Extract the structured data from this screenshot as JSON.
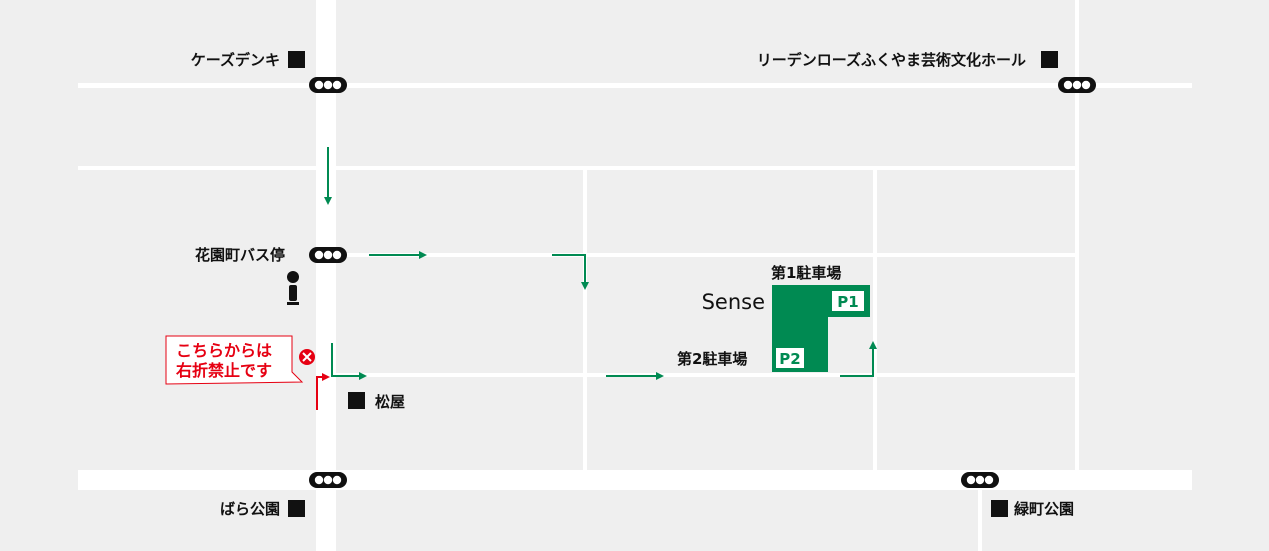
{
  "colors": {
    "route": "#008a52",
    "warning": "#e60012",
    "road": "#ffffff",
    "background": "#efefef"
  },
  "landmarks": {
    "k_denki": "ケーズデンキ",
    "hall": "リーデンローズふくやま芸術文化ホール",
    "bus_stop": "花園町バス停",
    "matsuya": "松屋",
    "bara_park": "ばら公園",
    "midorimachi_park": "緑町公園"
  },
  "destination": {
    "name": "Sense",
    "parking1_label": "第1駐車場",
    "parking1_badge": "P1",
    "parking2_label": "第2駐車場",
    "parking2_badge": "P2"
  },
  "warning": {
    "line1": "こちらからは",
    "line2": "右折禁止です",
    "icon": "no-entry-icon"
  }
}
